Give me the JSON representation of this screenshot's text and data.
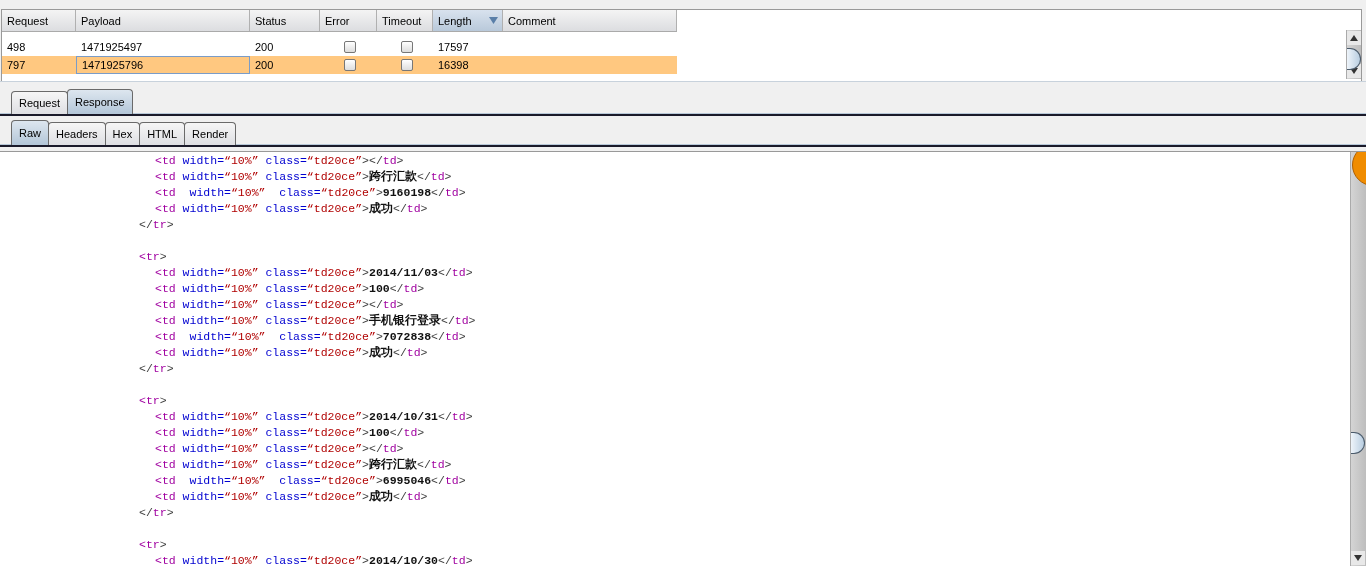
{
  "results": {
    "columns": [
      {
        "label": "Request",
        "sorted": false
      },
      {
        "label": "Payload",
        "sorted": false
      },
      {
        "label": "Status",
        "sorted": false
      },
      {
        "label": "Error",
        "sorted": false
      },
      {
        "label": "Timeout",
        "sorted": false
      },
      {
        "label": "Length",
        "sorted": true
      },
      {
        "label": "Comment",
        "sorted": false
      }
    ],
    "rows": [
      {
        "request": "498",
        "payload": "1471925497",
        "status": "200",
        "error": false,
        "timeout": false,
        "length": "17597",
        "selected": false
      },
      {
        "request": "797",
        "payload": "1471925796",
        "status": "200",
        "error": false,
        "timeout": false,
        "length": "16398",
        "selected": true
      }
    ]
  },
  "message_tabs": [
    {
      "label": "Request",
      "selected": false
    },
    {
      "label": "Response",
      "selected": true
    }
  ],
  "view_tabs": [
    {
      "label": "Raw",
      "selected": true
    },
    {
      "label": "Headers",
      "selected": false
    },
    {
      "label": "Hex",
      "selected": false
    },
    {
      "label": "HTML",
      "selected": false
    },
    {
      "label": "Render",
      "selected": false
    }
  ],
  "code_lines": [
    {
      "kind": "td",
      "tokens": [
        {
          "kind": "tag",
          "text": "<td"
        },
        {
          "kind": "attr",
          "text": " width="
        },
        {
          "kind": "value",
          "text": "“10%”"
        },
        {
          "kind": "attr",
          "text": " class="
        },
        {
          "kind": "value",
          "text": "“td20ce”"
        },
        {
          "kind": "punct",
          "text": ">"
        },
        {
          "kind": "punct",
          "text": "</"
        },
        {
          "kind": "tag",
          "text": "td"
        },
        {
          "kind": "punct",
          "text": ">"
        }
      ]
    },
    {
      "kind": "td",
      "tokens": [
        {
          "kind": "tag",
          "text": "<td"
        },
        {
          "kind": "attr",
          "text": " width="
        },
        {
          "kind": "value",
          "text": "“10%”"
        },
        {
          "kind": "attr",
          "text": " class="
        },
        {
          "kind": "value",
          "text": "“td20ce”"
        },
        {
          "kind": "punct",
          "text": ">"
        },
        {
          "kind": "text",
          "text": "跨行汇款"
        },
        {
          "kind": "punct",
          "text": "</"
        },
        {
          "kind": "tag",
          "text": "td"
        },
        {
          "kind": "punct",
          "text": ">"
        }
      ]
    },
    {
      "kind": "td",
      "tokens": [
        {
          "kind": "tag",
          "text": "<td"
        },
        {
          "kind": "attr",
          "text": "  width="
        },
        {
          "kind": "value",
          "text": "“10%”"
        },
        {
          "kind": "attr",
          "text": "  class="
        },
        {
          "kind": "value",
          "text": "“td20ce”"
        },
        {
          "kind": "punct",
          "text": ">"
        },
        {
          "kind": "text",
          "text": "9160198"
        },
        {
          "kind": "punct",
          "text": "</"
        },
        {
          "kind": "tag",
          "text": "td"
        },
        {
          "kind": "punct",
          "text": ">"
        }
      ]
    },
    {
      "kind": "td",
      "tokens": [
        {
          "kind": "tag",
          "text": "<td"
        },
        {
          "kind": "attr",
          "text": " width="
        },
        {
          "kind": "value",
          "text": "“10%”"
        },
        {
          "kind": "attr",
          "text": " class="
        },
        {
          "kind": "value",
          "text": "“td20ce”"
        },
        {
          "kind": "punct",
          "text": ">"
        },
        {
          "kind": "text",
          "text": "成功"
        },
        {
          "kind": "punct",
          "text": "</"
        },
        {
          "kind": "tag",
          "text": "td"
        },
        {
          "kind": "punct",
          "text": ">"
        }
      ]
    },
    {
      "kind": "tr",
      "tokens": [
        {
          "kind": "punct",
          "text": "</"
        },
        {
          "kind": "tag",
          "text": "tr"
        },
        {
          "kind": "punct",
          "text": ">"
        }
      ]
    },
    {
      "kind": "blank"
    },
    {
      "kind": "tr",
      "tokens": [
        {
          "kind": "tag",
          "text": "<tr"
        },
        {
          "kind": "punct",
          "text": ">"
        }
      ]
    },
    {
      "kind": "td",
      "tokens": [
        {
          "kind": "tag",
          "text": "<td"
        },
        {
          "kind": "attr",
          "text": " width="
        },
        {
          "kind": "value",
          "text": "“10%”"
        },
        {
          "kind": "attr",
          "text": " class="
        },
        {
          "kind": "value",
          "text": "“td20ce”"
        },
        {
          "kind": "punct",
          "text": ">"
        },
        {
          "kind": "text",
          "text": "2014/11/03"
        },
        {
          "kind": "punct",
          "text": "</"
        },
        {
          "kind": "tag",
          "text": "td"
        },
        {
          "kind": "punct",
          "text": ">"
        }
      ]
    },
    {
      "kind": "td",
      "tokens": [
        {
          "kind": "tag",
          "text": "<td"
        },
        {
          "kind": "attr",
          "text": " width="
        },
        {
          "kind": "value",
          "text": "“10%”"
        },
        {
          "kind": "attr",
          "text": " class="
        },
        {
          "kind": "value",
          "text": "“td20ce”"
        },
        {
          "kind": "punct",
          "text": ">"
        },
        {
          "kind": "text",
          "text": "100"
        },
        {
          "kind": "punct",
          "text": "</"
        },
        {
          "kind": "tag",
          "text": "td"
        },
        {
          "kind": "punct",
          "text": ">"
        }
      ]
    },
    {
      "kind": "td",
      "tokens": [
        {
          "kind": "tag",
          "text": "<td"
        },
        {
          "kind": "attr",
          "text": " width="
        },
        {
          "kind": "value",
          "text": "“10%”"
        },
        {
          "kind": "attr",
          "text": " class="
        },
        {
          "kind": "value",
          "text": "“td20ce”"
        },
        {
          "kind": "punct",
          "text": ">"
        },
        {
          "kind": "punct",
          "text": "</"
        },
        {
          "kind": "tag",
          "text": "td"
        },
        {
          "kind": "punct",
          "text": ">"
        }
      ]
    },
    {
      "kind": "td",
      "tokens": [
        {
          "kind": "tag",
          "text": "<td"
        },
        {
          "kind": "attr",
          "text": " width="
        },
        {
          "kind": "value",
          "text": "“10%”"
        },
        {
          "kind": "attr",
          "text": " class="
        },
        {
          "kind": "value",
          "text": "“td20ce”"
        },
        {
          "kind": "punct",
          "text": ">"
        },
        {
          "kind": "text",
          "text": "手机银行登录"
        },
        {
          "kind": "punct",
          "text": "</"
        },
        {
          "kind": "tag",
          "text": "td"
        },
        {
          "kind": "punct",
          "text": ">"
        }
      ]
    },
    {
      "kind": "td",
      "tokens": [
        {
          "kind": "tag",
          "text": "<td"
        },
        {
          "kind": "attr",
          "text": "  width="
        },
        {
          "kind": "value",
          "text": "“10%”"
        },
        {
          "kind": "attr",
          "text": "  class="
        },
        {
          "kind": "value",
          "text": "“td20ce”"
        },
        {
          "kind": "punct",
          "text": ">"
        },
        {
          "kind": "text",
          "text": "7072838"
        },
        {
          "kind": "punct",
          "text": "</"
        },
        {
          "kind": "tag",
          "text": "td"
        },
        {
          "kind": "punct",
          "text": ">"
        }
      ]
    },
    {
      "kind": "td",
      "tokens": [
        {
          "kind": "tag",
          "text": "<td"
        },
        {
          "kind": "attr",
          "text": " width="
        },
        {
          "kind": "value",
          "text": "“10%”"
        },
        {
          "kind": "attr",
          "text": " class="
        },
        {
          "kind": "value",
          "text": "“td20ce”"
        },
        {
          "kind": "punct",
          "text": ">"
        },
        {
          "kind": "text",
          "text": "成功"
        },
        {
          "kind": "punct",
          "text": "</"
        },
        {
          "kind": "tag",
          "text": "td"
        },
        {
          "kind": "punct",
          "text": ">"
        }
      ]
    },
    {
      "kind": "tr",
      "tokens": [
        {
          "kind": "punct",
          "text": "</"
        },
        {
          "kind": "tag",
          "text": "tr"
        },
        {
          "kind": "punct",
          "text": ">"
        }
      ]
    },
    {
      "kind": "blank"
    },
    {
      "kind": "tr",
      "tokens": [
        {
          "kind": "tag",
          "text": "<tr"
        },
        {
          "kind": "punct",
          "text": ">"
        }
      ]
    },
    {
      "kind": "td",
      "tokens": [
        {
          "kind": "tag",
          "text": "<td"
        },
        {
          "kind": "attr",
          "text": " width="
        },
        {
          "kind": "value",
          "text": "“10%”"
        },
        {
          "kind": "attr",
          "text": " class="
        },
        {
          "kind": "value",
          "text": "“td20ce”"
        },
        {
          "kind": "punct",
          "text": ">"
        },
        {
          "kind": "text",
          "text": "2014/10/31"
        },
        {
          "kind": "punct",
          "text": "</"
        },
        {
          "kind": "tag",
          "text": "td"
        },
        {
          "kind": "punct",
          "text": ">"
        }
      ]
    },
    {
      "kind": "td",
      "tokens": [
        {
          "kind": "tag",
          "text": "<td"
        },
        {
          "kind": "attr",
          "text": " width="
        },
        {
          "kind": "value",
          "text": "“10%”"
        },
        {
          "kind": "attr",
          "text": " class="
        },
        {
          "kind": "value",
          "text": "“td20ce”"
        },
        {
          "kind": "punct",
          "text": ">"
        },
        {
          "kind": "text",
          "text": "100"
        },
        {
          "kind": "punct",
          "text": "</"
        },
        {
          "kind": "tag",
          "text": "td"
        },
        {
          "kind": "punct",
          "text": ">"
        }
      ]
    },
    {
      "kind": "td",
      "tokens": [
        {
          "kind": "tag",
          "text": "<td"
        },
        {
          "kind": "attr",
          "text": " width="
        },
        {
          "kind": "value",
          "text": "“10%”"
        },
        {
          "kind": "attr",
          "text": " class="
        },
        {
          "kind": "value",
          "text": "“td20ce”"
        },
        {
          "kind": "punct",
          "text": ">"
        },
        {
          "kind": "punct",
          "text": "</"
        },
        {
          "kind": "tag",
          "text": "td"
        },
        {
          "kind": "punct",
          "text": ">"
        }
      ]
    },
    {
      "kind": "td",
      "tokens": [
        {
          "kind": "tag",
          "text": "<td"
        },
        {
          "kind": "attr",
          "text": " width="
        },
        {
          "kind": "value",
          "text": "“10%”"
        },
        {
          "kind": "attr",
          "text": " class="
        },
        {
          "kind": "value",
          "text": "“td20ce”"
        },
        {
          "kind": "punct",
          "text": ">"
        },
        {
          "kind": "text",
          "text": "跨行汇款"
        },
        {
          "kind": "punct",
          "text": "</"
        },
        {
          "kind": "tag",
          "text": "td"
        },
        {
          "kind": "punct",
          "text": ">"
        }
      ]
    },
    {
      "kind": "td",
      "tokens": [
        {
          "kind": "tag",
          "text": "<td"
        },
        {
          "kind": "attr",
          "text": "  width="
        },
        {
          "kind": "value",
          "text": "“10%”"
        },
        {
          "kind": "attr",
          "text": "  class="
        },
        {
          "kind": "value",
          "text": "“td20ce”"
        },
        {
          "kind": "punct",
          "text": ">"
        },
        {
          "kind": "text",
          "text": "6995046"
        },
        {
          "kind": "punct",
          "text": "</"
        },
        {
          "kind": "tag",
          "text": "td"
        },
        {
          "kind": "punct",
          "text": ">"
        }
      ]
    },
    {
      "kind": "td",
      "tokens": [
        {
          "kind": "tag",
          "text": "<td"
        },
        {
          "kind": "attr",
          "text": " width="
        },
        {
          "kind": "value",
          "text": "“10%”"
        },
        {
          "kind": "attr",
          "text": " class="
        },
        {
          "kind": "value",
          "text": "“td20ce”"
        },
        {
          "kind": "punct",
          "text": ">"
        },
        {
          "kind": "text",
          "text": "成功"
        },
        {
          "kind": "punct",
          "text": "</"
        },
        {
          "kind": "tag",
          "text": "td"
        },
        {
          "kind": "punct",
          "text": ">"
        }
      ]
    },
    {
      "kind": "tr",
      "tokens": [
        {
          "kind": "punct",
          "text": "</"
        },
        {
          "kind": "tag",
          "text": "tr"
        },
        {
          "kind": "punct",
          "text": ">"
        }
      ]
    },
    {
      "kind": "blank"
    },
    {
      "kind": "tr",
      "tokens": [
        {
          "kind": "tag",
          "text": "<tr"
        },
        {
          "kind": "punct",
          "text": ">"
        }
      ]
    },
    {
      "kind": "td",
      "tokens": [
        {
          "kind": "tag",
          "text": "<td"
        },
        {
          "kind": "attr",
          "text": " width="
        },
        {
          "kind": "value",
          "text": "“10%”"
        },
        {
          "kind": "attr",
          "text": " class="
        },
        {
          "kind": "value",
          "text": "“td20ce”"
        },
        {
          "kind": "punct",
          "text": ">"
        },
        {
          "kind": "text",
          "text": "2014/10/30"
        },
        {
          "kind": "punct",
          "text": "</"
        },
        {
          "kind": "tag",
          "text": "td"
        },
        {
          "kind": "punct",
          "text": ">"
        }
      ]
    }
  ]
}
